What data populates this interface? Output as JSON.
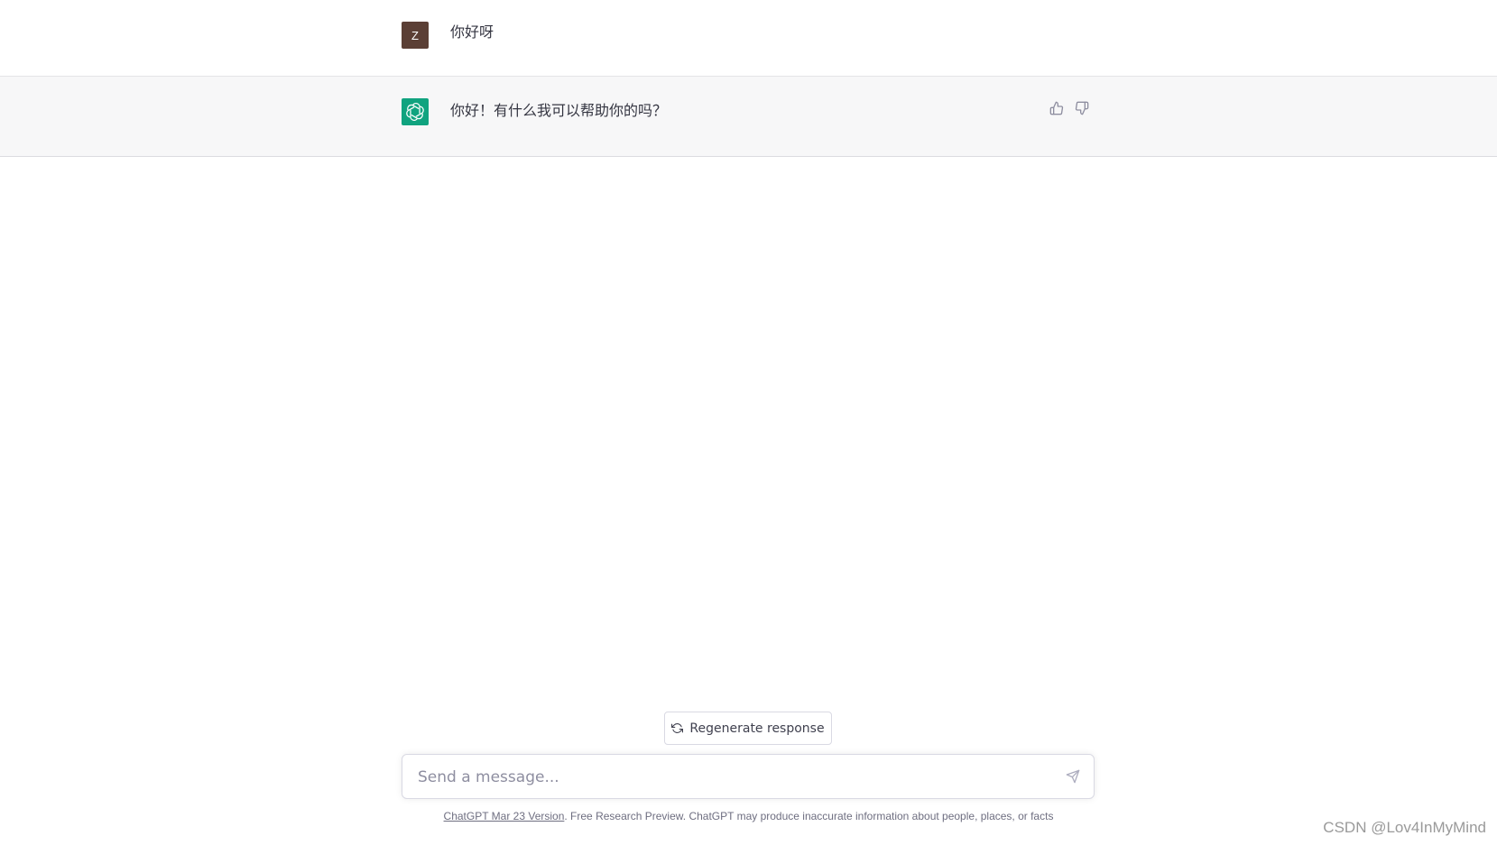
{
  "conversation": {
    "user_message": {
      "avatar_letter": "Z",
      "avatar_color": "#5b3f35",
      "text": "你好呀"
    },
    "assistant_message": {
      "avatar_icon": "openai-logo-icon",
      "avatar_color": "#10a37f",
      "text": "你好！有什么我可以帮助你的吗？",
      "feedback": {
        "thumbs_up_icon": "thumbs-up-icon",
        "thumbs_down_icon": "thumbs-down-icon"
      }
    }
  },
  "controls": {
    "regenerate_label": "Regenerate response",
    "regenerate_icon": "refresh-icon",
    "input_placeholder": "Send a message...",
    "send_icon": "send-icon"
  },
  "footer": {
    "version_link": "ChatGPT Mar 23 Version",
    "disclaimer": ". Free Research Preview. ChatGPT may produce inaccurate information about people, places, or facts"
  },
  "watermark": "CSDN @Lov4InMyMind"
}
